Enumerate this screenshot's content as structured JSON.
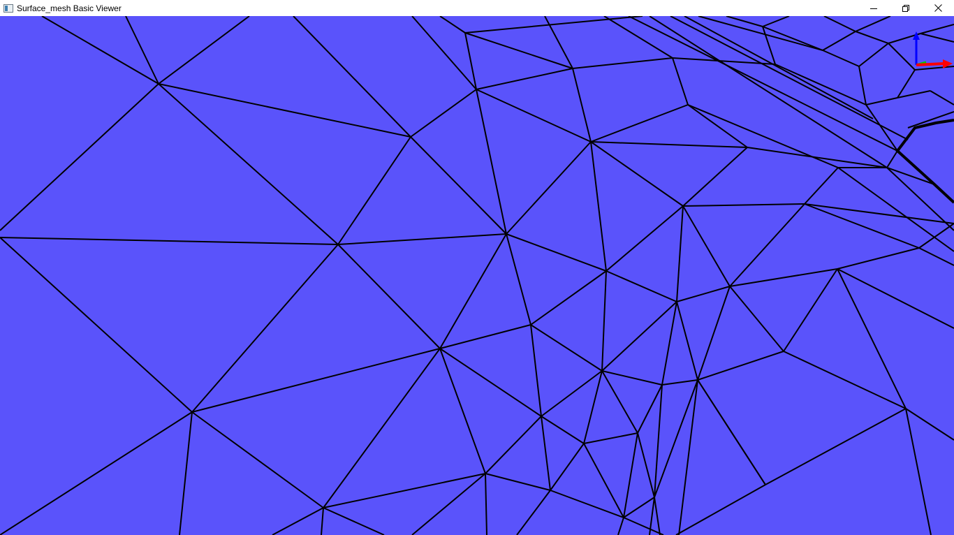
{
  "window": {
    "title": "Surface_mesh Basic Viewer",
    "icons": {
      "app": "app-window-icon",
      "minimize": "minimize-icon",
      "maximize": "restore-icon",
      "close": "close-icon"
    }
  },
  "viewer": {
    "face_color": "#5a53fb",
    "edge_color": "#000000",
    "background_color": "#ffffff",
    "axis_colors": {
      "x": "#ff0000",
      "y": "#00cc00",
      "z": "#0000ff"
    }
  }
}
